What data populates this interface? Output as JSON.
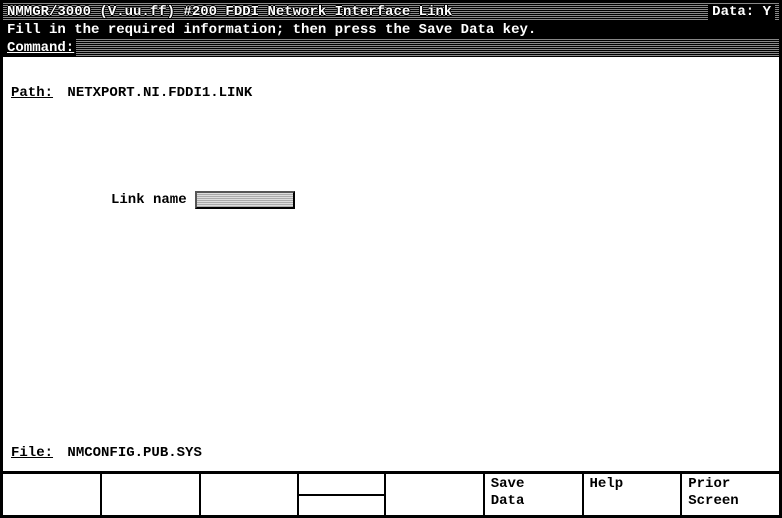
{
  "header": {
    "title": "NMMGR/3000 (V.uu.ff) #200  FDDI Network Interface Link",
    "data_label": "Data:",
    "data_value": "Y"
  },
  "instruction": "Fill in the required information; then press the Save Data key.",
  "command": {
    "label": "Command:",
    "value": ""
  },
  "path": {
    "label": "Path:",
    "value": "NETXPORT.NI.FDDI1.LINK"
  },
  "form": {
    "link_name_label": "Link name",
    "link_name_value": ""
  },
  "file": {
    "label": "File:",
    "value": "NMCONFIG.PUB.SYS"
  },
  "fkeys": {
    "f1": "",
    "f2": "",
    "f3": "",
    "f4a": "",
    "f4b": "",
    "f5": "",
    "f6_line1": "Save",
    "f6_line2": "Data",
    "f7_line1": "Help",
    "f7_line2": "",
    "f8_line1": "Prior",
    "f8_line2": "Screen"
  }
}
